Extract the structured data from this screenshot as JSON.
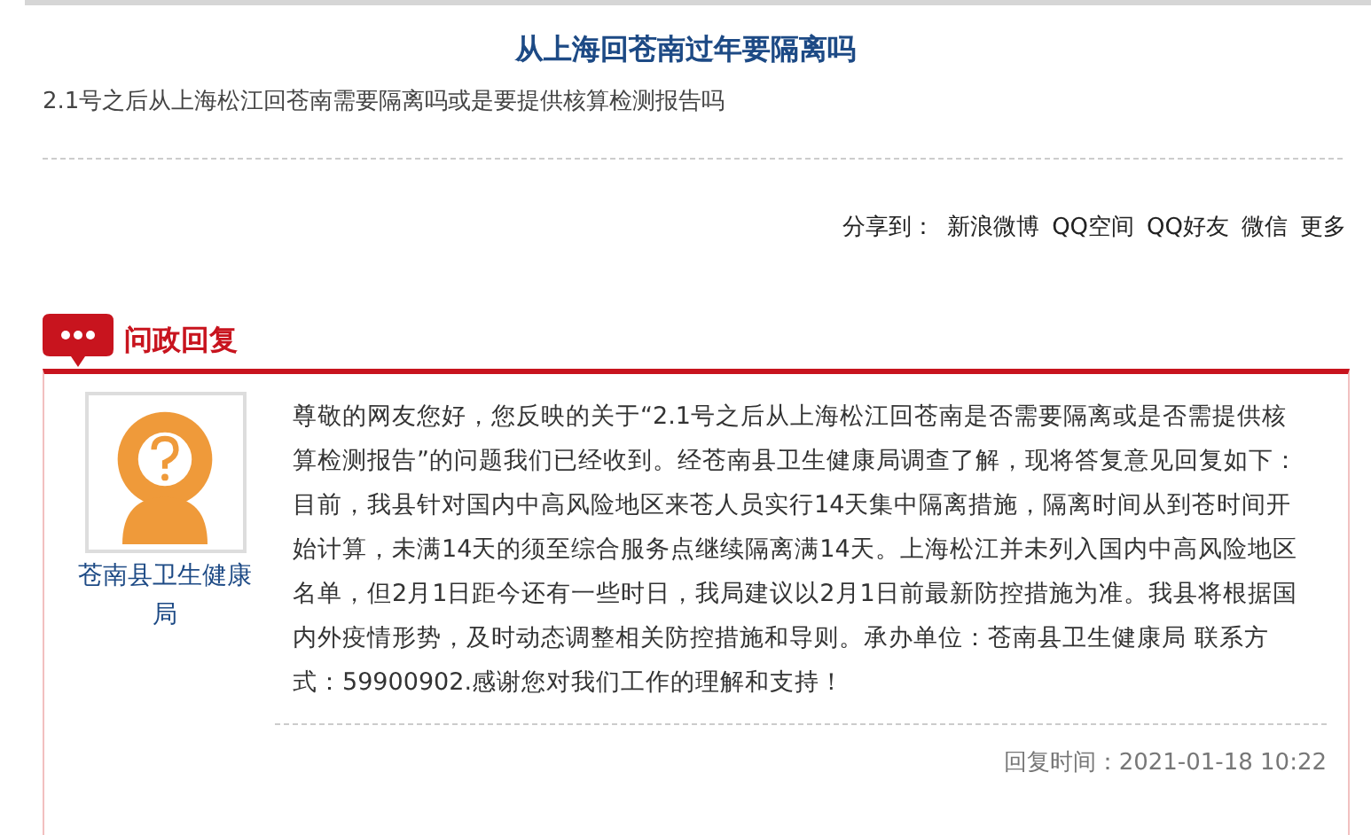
{
  "question": {
    "title": "从上海回苍南过年要隔离吗",
    "body": "2.1号之后从上海松江回苍南需要隔离吗或是要提供核算检测报告吗"
  },
  "share": {
    "label": "分享到：",
    "targets": [
      "新浪微博",
      "QQ空间",
      "QQ好友",
      "微信",
      "更多"
    ]
  },
  "reply_section": {
    "heading": "问政回复",
    "responder": "苍南县卫生健康局",
    "body": "尊敬的网友您好，您反映的关于“2.1号之后从上海松江回苍南是否需要隔离或是否需提供核算检测报告”的问题我们已经收到。经苍南县卫生健康局调查了解，现将答复意见回复如下：目前，我县针对国内中高风险地区来苍人员实行14天集中隔离措施，隔离时间从到苍时间开始计算，未满14天的须至综合服务点继续隔离满14天。上海松江并未列入国内中高风险地区名单，但2月1日距今还有一些时日，我局建议以2月1日前最新防控措施为准。我县将根据国内外疫情形势，及时动态调整相关防控措施和导则。承办单位：苍南县卫生健康局 联系方式：59900902.感谢您对我们工作的理解和支持！",
    "reply_time": "回复时间：2021-01-18 10:22"
  }
}
